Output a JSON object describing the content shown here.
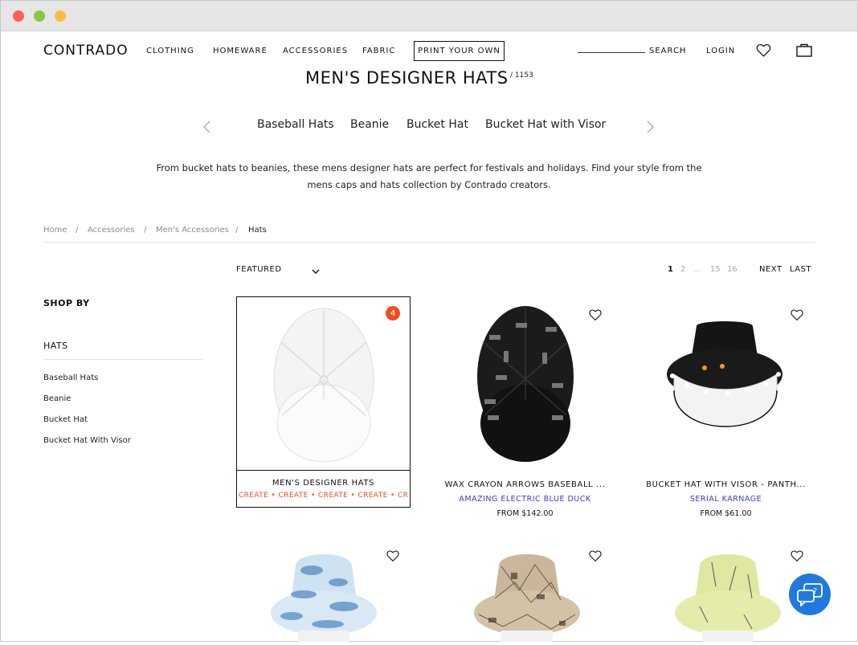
{
  "window": {
    "controls": [
      "close",
      "minimize",
      "zoom"
    ]
  },
  "header": {
    "logo": "CONTRADO",
    "nav": [
      "CLOTHING",
      "HOMEWARE",
      "ACCESSORIES",
      "FABRIC"
    ],
    "print_your_own": "PRINT YOUR OWN",
    "search_label": "SEARCH",
    "login": "LOGIN",
    "icons": [
      "heart-icon",
      "bag-icon"
    ]
  },
  "page": {
    "title": "MEN'S DESIGNER HATS",
    "count": "/ 1153",
    "subcategories": [
      "Baseball Hats",
      "Beanie",
      "Bucket Hat",
      "Bucket Hat with Visor"
    ],
    "description": "From bucket hats to beanies, these mens designer hats are perfect for festivals and holidays. Find your style from the mens caps and hats collection by Contrado creators."
  },
  "breadcrumb": [
    "Home",
    "Accessories",
    "Men's Accessories",
    "Hats"
  ],
  "toolbar": {
    "sort_label": "FEATURED",
    "pagination": [
      "1",
      "2",
      "...",
      "15",
      "16"
    ],
    "next": "NEXT",
    "last": "LAST"
  },
  "sidebar": {
    "shop_by": "SHOP BY",
    "group_title": "HATS",
    "filters": [
      "Baseball Hats",
      "Beanie",
      "Bucket Hat",
      "Bucket Hat With Visor"
    ]
  },
  "products": [
    {
      "title": "MEN'S DESIGNER HATS",
      "badge": "4",
      "create_strip": "CREATE • CREATE • CREATE • CREATE • CREATE"
    },
    {
      "title": "WAX CRAYON ARROWS BASEBALL ...",
      "creator": "AMAZING ELECTRIC BLUE DUCK",
      "price": "FROM $142.00"
    },
    {
      "title": "BUCKET HAT WITH VISOR - PANTH...",
      "creator": "SERIAL KARNAGE",
      "price": "FROM $61.00"
    }
  ],
  "colors": {
    "accent": "#f04e1f",
    "creator": "#3b3bd6",
    "chat": "#1f7ae0"
  }
}
